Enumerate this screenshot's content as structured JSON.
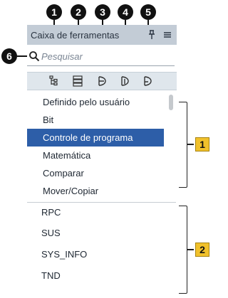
{
  "callouts": [
    "1",
    "2",
    "3",
    "4",
    "5",
    "6"
  ],
  "panel": {
    "title": "Caixa de ferramentas",
    "pin_icon": "pin-icon",
    "menu_icon": "menu-icon"
  },
  "search": {
    "placeholder": "Pesquisar",
    "value": ""
  },
  "toolbar_icons": [
    "tree-expand-icon",
    "tree-collapse-icon",
    "instruction-icon",
    "instruction-alt-icon",
    "instruction-favorite-icon"
  ],
  "categories": {
    "items": [
      "Definido pelo usuário",
      "Bit",
      "Controle de programa",
      "Matemática",
      "Comparar",
      "Mover/Copiar"
    ],
    "selected_index": 2
  },
  "instructions": {
    "items": [
      "RPC",
      "SUS",
      "SYS_INFO",
      "TND"
    ]
  },
  "section_badges": [
    "1",
    "2"
  ],
  "colors": {
    "selection": "#2d5ea8",
    "titlebar": "#c3ccd6",
    "badge": "#f1c12b"
  }
}
